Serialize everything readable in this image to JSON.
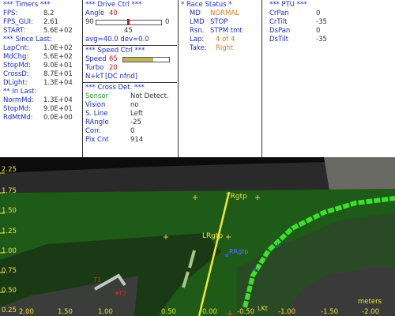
{
  "timers": {
    "title": "*** Timers ***",
    "fps_label": "FPS:",
    "fps_value": "8.2",
    "fps_gui_label": "FPS_GUI:",
    "fps_gui_value": "2.61",
    "start_label": "START:",
    "start_value": "5.6E+02",
    "since_last_title": "*** Since Last:",
    "lapcnt_label": "LapCnt:",
    "lapcnt_value": "1.0E+02",
    "mdchg_label": "MdChg:",
    "mdchg_value": "5.6E+02",
    "stopmd_label": "StopMd:",
    "stopmd_value": "9.0E+01",
    "crossd_label": "CrossD:",
    "crossd_value": "8.7E+01",
    "dlight_label": "DLight:",
    "dlight_value": "1.3E+04",
    "in_last_title": "** In Last:",
    "normmd_label": "NormMd:",
    "normmd_value": "1.3E+04",
    "stopmd2_label": "StopMd:",
    "stopmd2_value": "9.0E+01",
    "rdmtmd_label": "RdMtMd:",
    "rdmtmd_value": "0.0E+00"
  },
  "drive_ctrl": {
    "title": "***  Drive Ctrl  ***",
    "angle_label": "Angle",
    "angle_value": "40",
    "slider_min": "90",
    "slider_max": "0",
    "slider_level": 0.5,
    "slider_center": "45",
    "avg_dev": "avg=40.0  dev=0.0"
  },
  "speed_ctrl": {
    "title": "***  Speed Ctrl  ***",
    "speed_label": "Speed",
    "speed_value": "65",
    "speed_level": 0.65,
    "turbo_label": "Turbo",
    "turbo_value": "20",
    "nkt_label": "N+kT",
    "nkt_value": "[DC nfnd]"
  },
  "cross_det": {
    "title": "*** Cross Det. ***",
    "sensor_label": "Sensor",
    "sensor_value": "Not Detect.",
    "vision_label": "Vision",
    "vision_value": "no",
    "sline_label": "S. Line",
    "sline_value": "Left",
    "rangle_label": "RAngle",
    "rangle_value": "-25",
    "corr_label": "Corr.",
    "corr_value": "0",
    "pixcnt_label": "Pix Cnt",
    "pixcnt_value": "914"
  },
  "race_status": {
    "title": "* Race Status *",
    "md_label": "MD",
    "md_value": "NORMAL",
    "lmd_label": "LMD",
    "lmd_value": "STOP",
    "rsn_label": "Rsn.",
    "rsn_value": "STPM tmt",
    "lap_label": "Lap:",
    "lap_value": "4 of 4",
    "take_label": "Take:",
    "take_value": "Right"
  },
  "ptu": {
    "title": "*** PTU ***",
    "crpan_label": "CrPan",
    "crpan_value": "0",
    "crtilt_label": "CrTilt",
    "crtilt_value": "-35",
    "dspan_label": "DsPan",
    "dspan_value": "0",
    "dstilt_label": "DsTilt",
    "dstilt_value": "-35"
  },
  "camera_view": {
    "y_ticks": [
      "2.25",
      "1.75",
      "1.50",
      "1.25",
      "1.00",
      "0.75",
      "0.50",
      "0.25"
    ],
    "x_ticks": [
      "2.00",
      "1.50",
      "1.00",
      "0.50",
      "0.00",
      "-0.50",
      "-1.00",
      "-1.50",
      "-2.00"
    ],
    "unit_label": "meters",
    "annotations": {
      "trgtp": "TRgtp",
      "lrgtp": "LRgtp",
      "rrgtp": "RRgtp",
      "lkt": "LKt",
      "t3": "T3",
      "t1": "T1"
    },
    "colors": {
      "track_green": "#1e5a18",
      "right_line": "#3ce02a",
      "target_line": "#f0ea30",
      "tick_yellow": "#e8e23a"
    }
  }
}
